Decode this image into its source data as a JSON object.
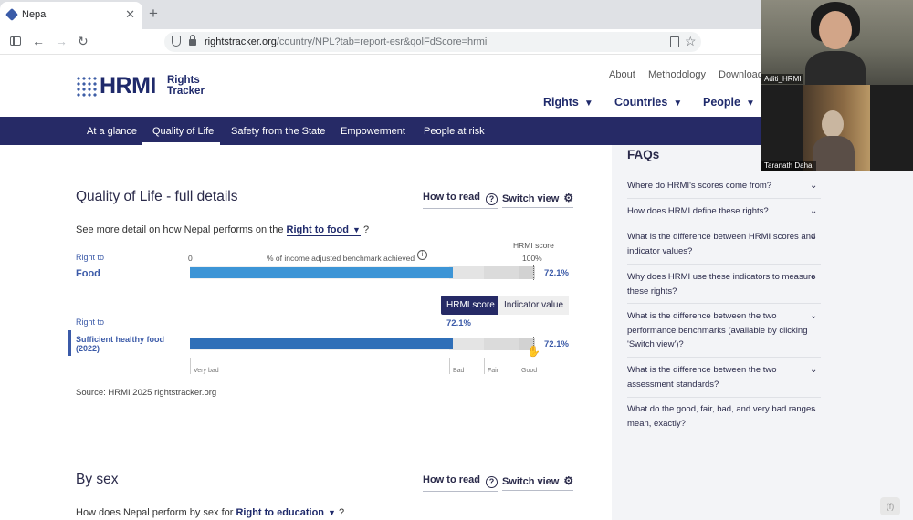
{
  "browser": {
    "tab_title": "Nepal",
    "close_glyph": "✕",
    "newtab_glyph": "+",
    "url_host": "rightstracker.org",
    "url_path": "/country/NPL?tab=report-esr&qolFdScore=hrmi",
    "icons": [
      "sidebar-toggle-icon",
      "back-arrow-icon",
      "forward-arrow-icon",
      "reload-icon",
      "shield-icon",
      "lock-icon",
      "reader-mode-icon",
      "bookmark-star-icon"
    ]
  },
  "header": {
    "logo_text": "HRMI",
    "logo_sub1": "Rights",
    "logo_sub2": "Tracker",
    "links": [
      "About",
      "Methodology",
      "Download"
    ],
    "nav": [
      "Rights",
      "Countries",
      "People"
    ]
  },
  "subnav": [
    "At a glance",
    "Quality of Life",
    "Safety from the State",
    "Empowerment",
    "People at risk"
  ],
  "main": {
    "title": "Quality of Life - full details",
    "how_to_read": "How to read",
    "switch_view": "Switch view",
    "perf_prefix": "See more detail on how Nepal performs on the",
    "perf_right": "Right to food",
    "perf_suffix": "?",
    "right_to_label": "Right to",
    "axis_zero": "0",
    "axis_caption": "% of income adjusted benchmark achieved",
    "hrmi_score_header": "HRMI score",
    "axis_100": "100%",
    "tooltip_hrmi": "HRMI score",
    "tooltip_indicator": "Indicator value",
    "tooltip_value": "72.1%",
    "source": "Source: HRMI 2025 rightstracker.org",
    "ranges": [
      "Very bad",
      "Bad",
      "Fair",
      "Good"
    ],
    "sec2_title": "By sex",
    "sec2_how": "How to read",
    "sec2_switch": "Switch view",
    "sec2_prefix": "How does Nepal perform by sex for",
    "sec2_right": "Right to education",
    "sec2_suffix": "?"
  },
  "chart_data": {
    "type": "bar",
    "categories": [
      "Food",
      "Sufficient healthy food (2022)"
    ],
    "values": [
      72.1,
      72.1
    ],
    "value_labels": [
      "72.1%",
      "72.1%"
    ],
    "xlabel": "% of income adjusted benchmark achieved",
    "xlim": [
      0,
      100
    ],
    "bar_colors": [
      "#3d95d6",
      "#2f6fb8"
    ]
  },
  "faq": {
    "heading": "FAQs",
    "items": [
      "Where do HRMI's scores come from?",
      "How does HRMI define these rights?",
      "What is the difference between HRMI scores and indicator values?",
      "Why does HRMI use these indicators to measure these rights?",
      "What is the difference between the two performance benchmarks (available by clicking 'Switch view')?",
      "What is the difference between the two assessment standards?",
      "What do the good, fair, bad, and very bad ranges mean, exactly?"
    ]
  },
  "video": {
    "participant1": "Aditi_HRMI",
    "participant2": "Taranath Dahal"
  },
  "corner_badge": "(f)"
}
